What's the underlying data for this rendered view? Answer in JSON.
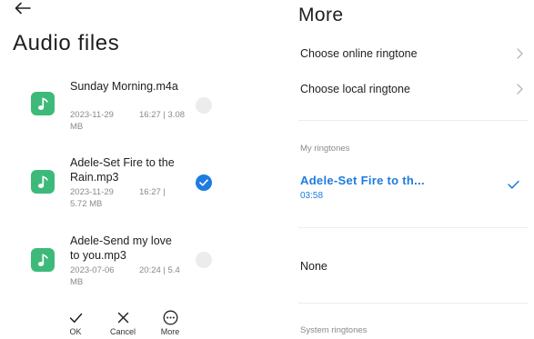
{
  "left": {
    "title": "Audio files",
    "files": [
      {
        "name": "Sunday Morning.m4a",
        "date": "2023-11-29",
        "time": "16:27",
        "sep": "|",
        "size_a": "3.08",
        "size_b": "MB",
        "selected": false
      },
      {
        "name": "Adele-Set Fire to the Rain.mp3",
        "date": "2023-11-29",
        "time": "16:27",
        "sep": "|",
        "size_a": "",
        "size_b": "5.72 MB",
        "selected": true
      },
      {
        "name": "Adele-Send my love to you.mp3",
        "date": "2023-07-06",
        "time": "20:24",
        "sep": "|",
        "size_a": "5.4",
        "size_b": "MB",
        "selected": false
      }
    ],
    "actions": {
      "ok": "OK",
      "cancel": "Cancel",
      "more": "More"
    }
  },
  "right": {
    "title": "More",
    "choose_online": "Choose online ringtone",
    "choose_local": "Choose local ringtone",
    "my_ringtones_header": "My ringtones",
    "selected_ringtone": {
      "name": "Adele-Set Fire to th...",
      "duration": "03:58"
    },
    "none_label": "None",
    "system_header": "System ringtones"
  },
  "colors": {
    "accent": "#1e7be0",
    "file_icon": "#3dba79",
    "muted": "#8a8a8a"
  },
  "icons": {
    "back": "arrow-left-icon",
    "file": "music-note-icon",
    "chevron": "chevron-right-icon",
    "check": "checkmark-icon",
    "ok": "checkmark-icon",
    "cancel": "close-icon",
    "more": "more-circle-icon"
  }
}
